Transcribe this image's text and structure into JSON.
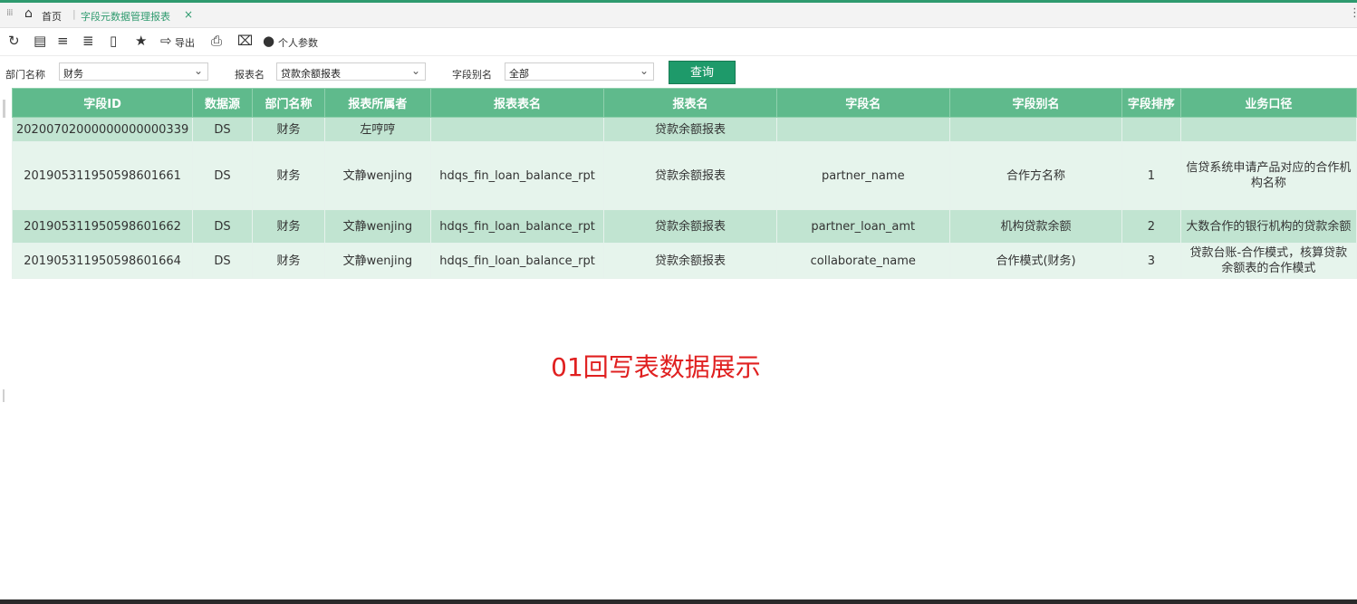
{
  "tabbar": {
    "menu_icon": "grid-menu-icon",
    "home_label": "首页",
    "active_tab_label": "字段元数据管理报表",
    "close_glyph": "×"
  },
  "toolbar": {
    "icons": [
      "refresh-icon",
      "save-icon",
      "expand-icon",
      "collapse-icon",
      "delete-icon",
      "star-icon",
      "export-icon",
      "print-icon",
      "excel-icon",
      "user-settings-icon"
    ],
    "export_label": "导出",
    "personal_params_label": "个人参数"
  },
  "filters": {
    "dept_label": "部门名称",
    "dept_value": "财务",
    "report_label": "报表名",
    "report_value": "贷款余额报表",
    "alias_label": "字段别名",
    "alias_value": "全部",
    "query_button": "查询"
  },
  "table": {
    "headers": [
      "字段ID",
      "数据源",
      "部门名称",
      "报表所属者",
      "报表表名",
      "报表名",
      "字段名",
      "字段别名",
      "字段排序",
      "业务口径"
    ],
    "rows": [
      [
        "20200702000000000000339",
        "DS",
        "财务",
        "左哼哼",
        "",
        "贷款余额报表",
        "",
        "",
        "",
        ""
      ],
      [
        "20190531195059860166​1",
        "DS",
        "财务",
        "文静wenjing",
        "hdqs_fin_loan_balance_rpt",
        "贷款余额报表",
        "partner_name",
        "合作方名称",
        "1",
        "信贷系统申请产品对应的合作机构名称"
      ],
      [
        "20190531195059860166​2",
        "DS",
        "财务",
        "文静wenjing",
        "hdqs_fin_loan_balance_rpt",
        "贷款余额报表",
        "partner_loan_amt",
        "机构贷款余额",
        "2",
        "大数合作的银行机构的贷款余额"
      ],
      [
        "20190531195059860166​4",
        "DS",
        "财务",
        "文静wenjing",
        "hdqs_fin_loan_balance_rpt",
        "贷款余额报表",
        "collaborate_name",
        "合作模式(财务)",
        "3",
        "贷款台账-合作模式，核算贷款余额表的合作模式"
      ]
    ]
  },
  "caption": "01回写表数据展示",
  "colors": {
    "accent": "#2e9a6e",
    "header_bg": "#5fba8c",
    "row_dark": "#c1e4d1",
    "row_light": "#e6f4ec",
    "caption": "#e02020"
  }
}
